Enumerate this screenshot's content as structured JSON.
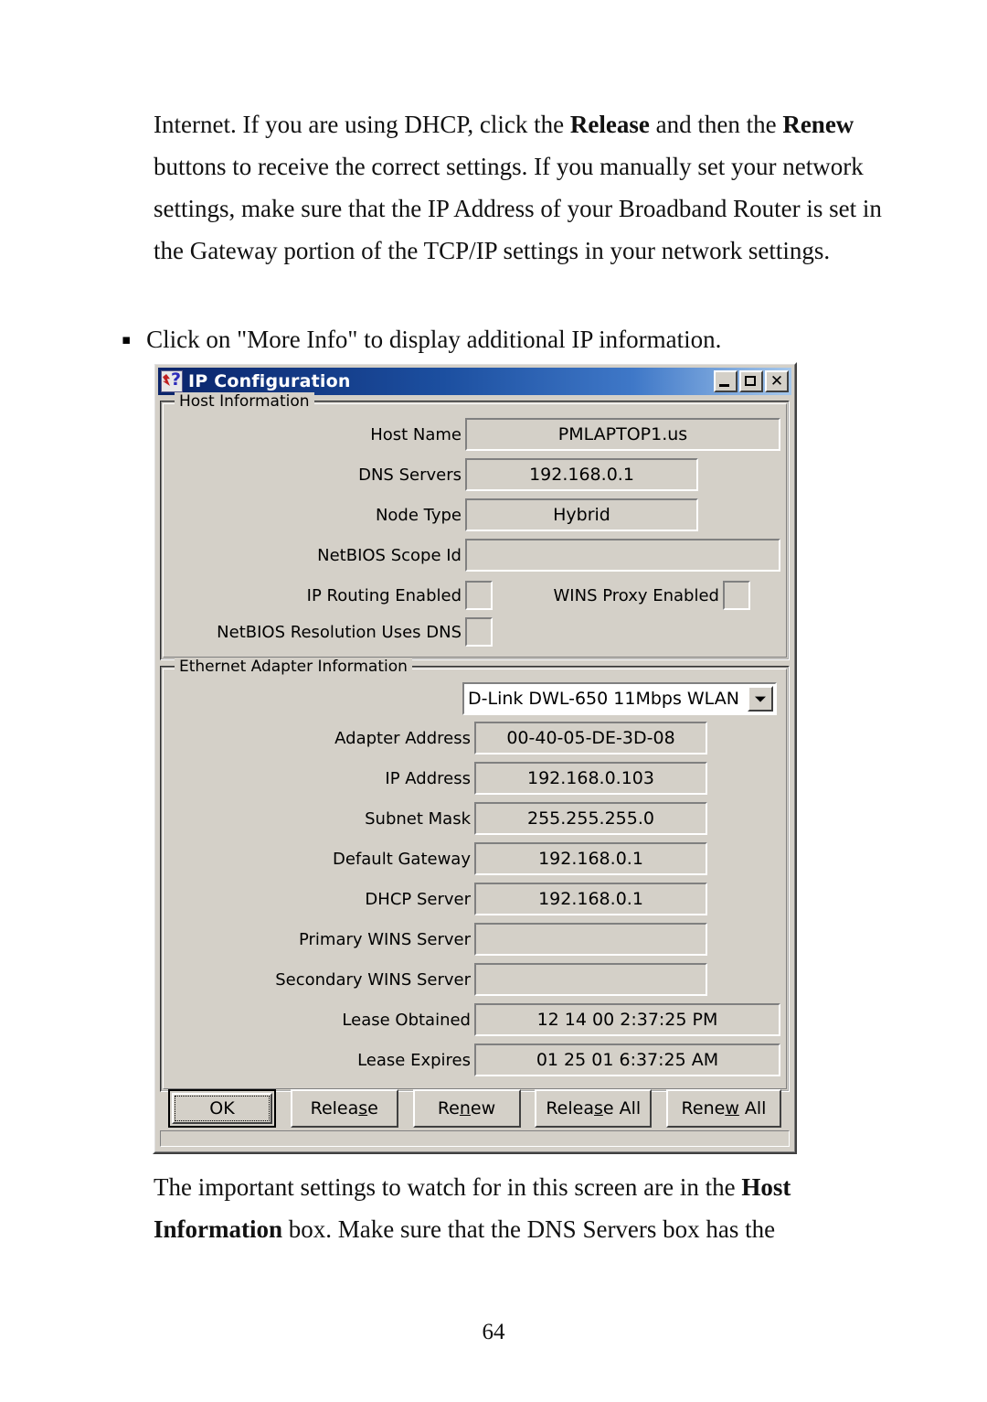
{
  "document": {
    "paragraph_top_html": "Internet. If you are using DHCP, click the <b>Release</b> and then the <b>Renew</b> buttons to receive the correct settings. If you manually set your network settings, make sure that the IP Address of your Broadband Router is set in the Gateway portion of the TCP/IP settings in your network settings.",
    "bullet_text": "Click on \"More Info\" to display additional IP information.",
    "bullet_marker": "▪",
    "paragraph_bottom_html": "The important settings to watch for in this screen are in the <b>Host Information</b> box. Make sure that the DNS Servers box has the",
    "page_number": "64"
  },
  "dialog": {
    "title": "IP Configuration",
    "title_icon": "ip-config-icon",
    "window_controls": {
      "minimize": "minimize-icon",
      "maximize": "maximize-icon",
      "close": "close-icon"
    },
    "host_information": {
      "legend": "Host Information",
      "rows": [
        {
          "label": "Host Name",
          "value": "PMLAPTOP1.us",
          "type": "text",
          "width": "wide"
        },
        {
          "label": "DNS Servers",
          "value": "192.168.0.1",
          "type": "text",
          "width": "narrow"
        },
        {
          "label": "Node Type",
          "value": "Hybrid",
          "type": "text",
          "width": "narrow"
        },
        {
          "label": "NetBIOS Scope Id",
          "value": "",
          "type": "text",
          "width": "wide"
        }
      ],
      "checks": [
        {
          "label": "IP Routing Enabled",
          "checked": false
        },
        {
          "label": "WINS Proxy Enabled",
          "checked": false
        },
        {
          "label": "NetBIOS Resolution Uses DNS",
          "checked": false
        }
      ]
    },
    "ethernet_adapter_information": {
      "legend": "Ethernet  Adapter Information",
      "adapter_selected": "D-Link DWL-650 11Mbps WLAN",
      "rows": [
        {
          "label": "Adapter Address",
          "value": "00-40-05-DE-3D-08",
          "width": "narrow"
        },
        {
          "label": "IP Address",
          "value": "192.168.0.103",
          "width": "narrow"
        },
        {
          "label": "Subnet Mask",
          "value": "255.255.255.0",
          "width": "narrow"
        },
        {
          "label": "Default Gateway",
          "value": "192.168.0.1",
          "width": "narrow"
        },
        {
          "label": "DHCP Server",
          "value": "192.168.0.1",
          "width": "narrow"
        },
        {
          "label": "Primary WINS Server",
          "value": "",
          "width": "narrow"
        },
        {
          "label": "Secondary WINS Server",
          "value": "",
          "width": "narrow"
        },
        {
          "label": "Lease Obtained",
          "value": "12 14 00 2:37:25 PM",
          "width": "wide"
        },
        {
          "label": "Lease Expires",
          "value": "01 25 01 6:37:25 AM",
          "width": "wide"
        }
      ]
    },
    "buttons": [
      {
        "label": "OK",
        "mnemonic_index": -1,
        "default": true,
        "name": "ok-button"
      },
      {
        "label": "Release",
        "mnemonic_index": 5,
        "default": false,
        "name": "release-button"
      },
      {
        "label": "Renew",
        "mnemonic_index": 2,
        "default": false,
        "name": "renew-button"
      },
      {
        "label": "Release All",
        "mnemonic_index": 5,
        "default": false,
        "name": "release-all-button"
      },
      {
        "label": "Renew All",
        "mnemonic_index": 4,
        "default": false,
        "name": "renew-all-button"
      }
    ]
  },
  "colors": {
    "titlebar_start": "#0a246a",
    "titlebar_end": "#a6c8ec",
    "dialog_face": "#d4d0c8",
    "shadow": "#808080",
    "highlight": "#ffffff",
    "page_background": "#ffffff",
    "text": "#000000"
  }
}
